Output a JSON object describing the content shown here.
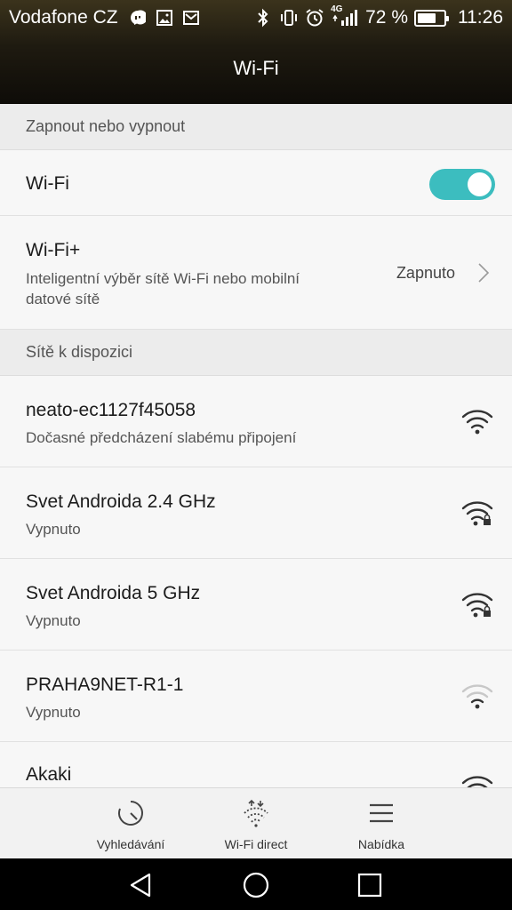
{
  "status_bar": {
    "carrier": "Vodafone CZ",
    "network_label": "4G",
    "battery_percent_text": "72 %",
    "battery_level": 0.72,
    "time": "11:26",
    "icons": [
      "chat-icon",
      "image-icon",
      "mail-icon",
      "bluetooth-icon",
      "vibrate-icon",
      "alarm-icon",
      "signal-icon",
      "battery-icon"
    ]
  },
  "header": {
    "title": "Wi-Fi"
  },
  "section_onoff": {
    "label": "Zapnout nebo vypnout"
  },
  "wifi_toggle": {
    "label": "Wi-Fi",
    "enabled": true,
    "accent": "#3cbdbf"
  },
  "wifi_plus": {
    "title": "Wi-Fi+",
    "subtitle_line1": "Inteligentní výběr sítě Wi-Fi nebo mobilní",
    "subtitle_line2": "datové sítě",
    "value": "Zapnuto"
  },
  "section_networks": {
    "label": "Sítě k dispozici"
  },
  "networks": [
    {
      "name": "neato-ec1127f45058",
      "status": "Dočasné předcházení slabému připojení",
      "locked": false,
      "icon": "wifi-icon"
    },
    {
      "name": "Svet Androida 2.4 GHz",
      "status": "Vypnuto",
      "locked": true,
      "icon": "wifi-lock-icon"
    },
    {
      "name": "Svet Androida 5 GHz",
      "status": "Vypnuto",
      "locked": true,
      "icon": "wifi-lock-icon"
    },
    {
      "name": "PRAHA9NET-R1-1",
      "status": "Vypnuto",
      "locked": false,
      "icon": "wifi-weak-icon"
    },
    {
      "name": "Akaki",
      "status": "",
      "locked": false,
      "icon": "wifi-icon"
    }
  ],
  "bottom_bar": {
    "scan_label": "Vyhledávání",
    "direct_label": "Wi-Fi direct",
    "menu_label": "Nabídka"
  },
  "nav_bar": {
    "icons": [
      "back-icon",
      "home-icon",
      "recents-icon"
    ]
  }
}
